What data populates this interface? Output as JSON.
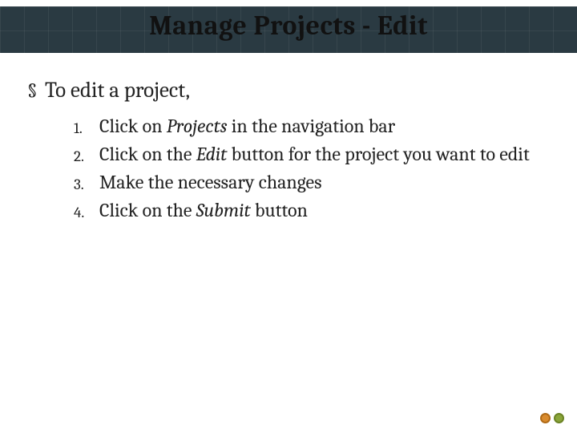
{
  "title": "Manage Projects - Edit",
  "bullet": {
    "marker": "§",
    "text": "To edit a project,"
  },
  "steps": [
    {
      "num": "1.",
      "pre": "Click on ",
      "em": "Projects",
      "post": " in the navigation bar"
    },
    {
      "num": "2.",
      "pre": "Click on the ",
      "em": "Edit",
      "post": " button for the project you want to edit"
    },
    {
      "num": "3.",
      "pre": "Make the necessary changes",
      "em": "",
      "post": ""
    },
    {
      "num": "4.",
      "pre": "Click on the ",
      "em": "Submit",
      "post": " button"
    }
  ]
}
